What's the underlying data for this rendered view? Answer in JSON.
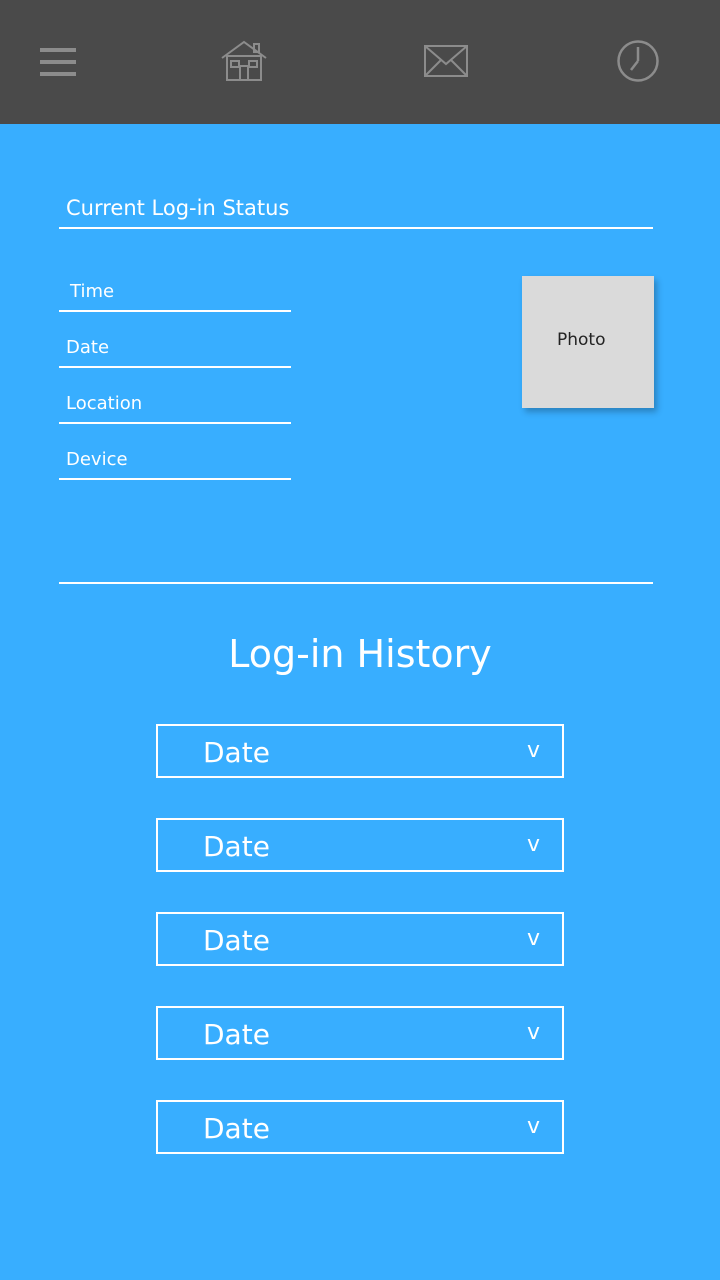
{
  "nav": {
    "icons": [
      "hamburger-menu-icon",
      "home-icon",
      "mail-icon",
      "clock-icon"
    ]
  },
  "current_status": {
    "title": "Current Log-in Status",
    "fields": [
      {
        "label": "Time"
      },
      {
        "label": "Date"
      },
      {
        "label": "Location"
      },
      {
        "label": "Device"
      }
    ],
    "photo_label": "Photo"
  },
  "history": {
    "title": "Log-in History",
    "items": [
      {
        "label": "Date",
        "chevron": "v"
      },
      {
        "label": "Date",
        "chevron": "v"
      },
      {
        "label": "Date",
        "chevron": "v"
      },
      {
        "label": "Date",
        "chevron": "v"
      },
      {
        "label": "Date",
        "chevron": "v"
      }
    ]
  },
  "colors": {
    "background": "#38AEFF",
    "topbar": "#4A4A4A",
    "icon": "#8C8C8C",
    "photo": "#DADADA"
  }
}
